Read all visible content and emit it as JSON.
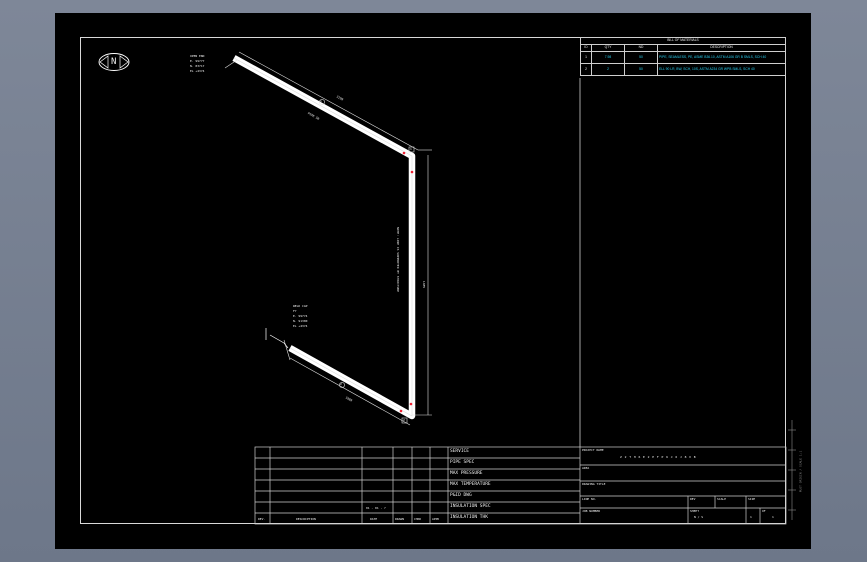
{
  "drawing": {
    "north_label": "N",
    "callouts": {
      "open_end": [
        "OPEN END",
        "E. 99777",
        "N. 83717",
        "EL +4374"
      ],
      "weld_cap": [
        "WELD CAP",
        "F7",
        "E. 99774",
        "N. 91300",
        "EL +4374"
      ]
    },
    "dimensions": {
      "top_run": "3190",
      "vertical_run": "1485",
      "bottom_run": "1980",
      "top_note": "PIPE 50",
      "vertical_note": "NOTE: LINE IS SUPPORTED BY STRUCTURE",
      "elevation": "EL + 4374"
    },
    "markers": {
      "m1": "1",
      "m2": "1",
      "m3": "2",
      "pipe_tag": "1",
      "pipe_tag2": "2"
    },
    "small_label": "D1"
  },
  "bom": {
    "title": "BILL OF MATERIALS",
    "headers": [
      "ID",
      "QTY",
      "ND",
      "DESCRIPTION"
    ],
    "rows": [
      {
        "id": "1",
        "qty": "7.98",
        "nd": "50",
        "desc": "PIPE, SEAMLESS, PE, ASME B36.10, ASTM A106 GR B SMLS, SCH 40"
      },
      {
        "id": "2",
        "qty": "2",
        "nd": "50",
        "desc": "ELL 90 LR, BW, SCH, 10S, ASTM A234 GR WPB SMLS, SCH 40"
      }
    ]
  },
  "title_block": {
    "fields": [
      "SERVICE",
      "PIPE SPEC",
      "MAX PRESSURE",
      "MAX TEMPERATURE",
      "P&ID DWG",
      "INSULATION SPEC",
      "INSULATION THK"
    ],
    "revision_headers": [
      "REV.",
      "DESCRIPTION",
      "DATE",
      "DRAWN",
      "CHKD",
      "APPD"
    ],
    "revision_note": "01 - 01 - ?",
    "right": {
      "project_name_label": "PROJECT NAME",
      "project_name_value": "Z 2 T H 6 E 2 E F P 6 J 6 J 8 X B",
      "area_label": "AREA",
      "drawing_title_label": "DRAWING TITLE",
      "line_no_label": "LINE NO.",
      "job_number_label": "JOB NUMBER",
      "rev_label": "REV",
      "scale_label": "SCALE",
      "size_label": "SIZE",
      "sheet_label": "SHEET",
      "of_label": "OF",
      "sheet_no": "1",
      "sheet_of": "1",
      "rev_value": "0",
      "scale_value": "N / S"
    }
  },
  "side_text": "PLOT ORIGIN / SCALE 1:1"
}
